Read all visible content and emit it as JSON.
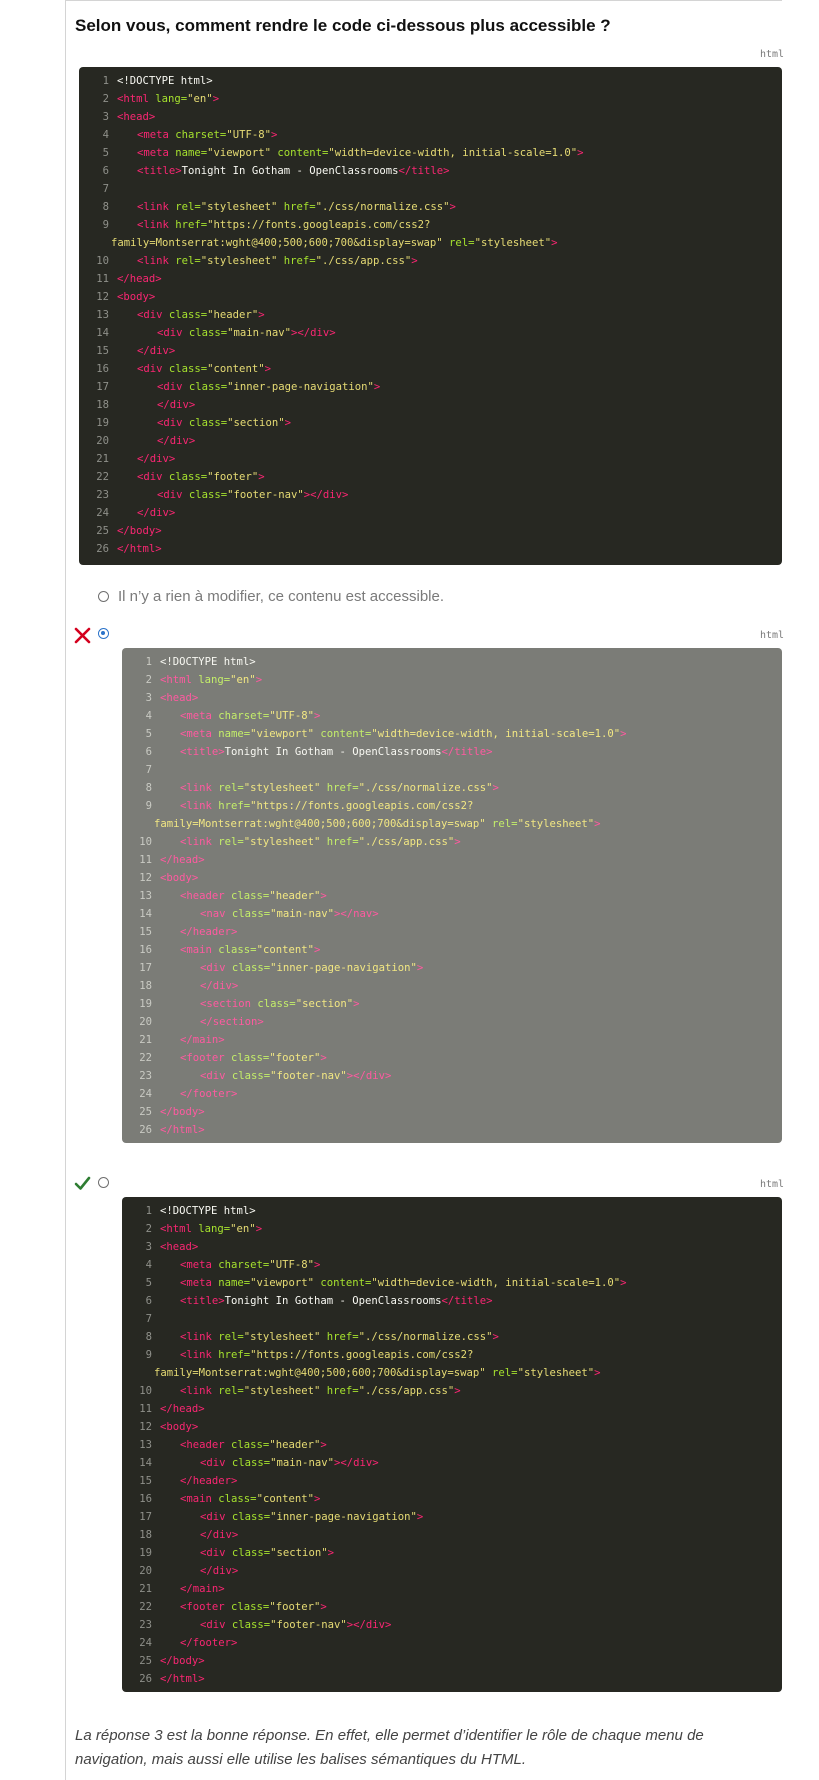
{
  "question": "Selon vous, comment rendre le code ci-dessous plus accessible ?",
  "lang_label": "html",
  "colors": {
    "tag": "#f92672",
    "attr": "#a6e22e",
    "string": "#e6db74",
    "text": "#f8f8f2",
    "wrong": "#d4001e",
    "right": "#2e7d32",
    "radio_selected": "#2a72c9"
  },
  "icons": {
    "wrong": "cross-icon",
    "right": "checkmark-icon"
  },
  "original_code": [
    {
      "n": "1",
      "x": 0,
      "s": [
        [
          "d",
          "<!DOCTYPE html>"
        ]
      ]
    },
    {
      "n": "2",
      "x": 0,
      "s": [
        [
          "t",
          "<html "
        ],
        [
          "a",
          "lang="
        ],
        [
          "s",
          "\"en\""
        ],
        [
          "t",
          ">"
        ]
      ]
    },
    {
      "n": "3",
      "x": 0,
      "s": [
        [
          "t",
          "<head>"
        ]
      ]
    },
    {
      "n": "4",
      "x": 1,
      "s": [
        [
          "t",
          "<meta "
        ],
        [
          "a",
          "charset="
        ],
        [
          "s",
          "\"UTF-8\""
        ],
        [
          "t",
          ">"
        ]
      ]
    },
    {
      "n": "5",
      "x": 1,
      "s": [
        [
          "t",
          "<meta "
        ],
        [
          "a",
          "name="
        ],
        [
          "s",
          "\"viewport\" "
        ],
        [
          "a",
          "content="
        ],
        [
          "s",
          "\"width=device-width, initial-scale=1.0\""
        ],
        [
          "t",
          ">"
        ]
      ]
    },
    {
      "n": "6",
      "x": 1,
      "s": [
        [
          "t",
          "<title>"
        ],
        [
          "p",
          "Tonight In Gotham - OpenClassrooms"
        ],
        [
          "t",
          "</title>"
        ]
      ]
    },
    {
      "n": "7",
      "x": 0,
      "s": []
    },
    {
      "n": "8",
      "x": 1,
      "s": [
        [
          "t",
          "<link "
        ],
        [
          "a",
          "rel="
        ],
        [
          "s",
          "\"stylesheet\" "
        ],
        [
          "a",
          "href="
        ],
        [
          "s",
          "\"./css/normalize.css\""
        ],
        [
          "t",
          ">"
        ]
      ]
    },
    {
      "n": "9",
      "x": 1,
      "s": [
        [
          "t",
          "<link "
        ],
        [
          "a",
          "href="
        ],
        [
          "s",
          "\"https://fonts.googleapis.com/css2?"
        ]
      ]
    },
    {
      "n": "",
      "x": -1,
      "s": [
        [
          "s",
          "family=Montserrat:wght@400;500;600;700&display=swap\" "
        ],
        [
          "a",
          "rel="
        ],
        [
          "s",
          "\"stylesheet\""
        ],
        [
          "t",
          ">"
        ]
      ]
    },
    {
      "n": "10",
      "x": 1,
      "s": [
        [
          "t",
          "<link "
        ],
        [
          "a",
          "rel="
        ],
        [
          "s",
          "\"stylesheet\" "
        ],
        [
          "a",
          "href="
        ],
        [
          "s",
          "\"./css/app.css\""
        ],
        [
          "t",
          ">"
        ]
      ]
    },
    {
      "n": "11",
      "x": 0,
      "s": [
        [
          "t",
          "</head>"
        ]
      ]
    },
    {
      "n": "12",
      "x": 0,
      "s": [
        [
          "t",
          "<body>"
        ]
      ]
    },
    {
      "n": "13",
      "x": 1,
      "s": [
        [
          "t",
          "<div "
        ],
        [
          "a",
          "class="
        ],
        [
          "s",
          "\"header\""
        ],
        [
          "t",
          ">"
        ]
      ]
    },
    {
      "n": "14",
      "x": 2,
      "s": [
        [
          "t",
          "<div "
        ],
        [
          "a",
          "class="
        ],
        [
          "s",
          "\"main-nav\""
        ],
        [
          "t",
          "></div>"
        ]
      ]
    },
    {
      "n": "15",
      "x": 1,
      "s": [
        [
          "t",
          "</div>"
        ]
      ]
    },
    {
      "n": "16",
      "x": 1,
      "s": [
        [
          "t",
          "<div "
        ],
        [
          "a",
          "class="
        ],
        [
          "s",
          "\"content\""
        ],
        [
          "t",
          ">"
        ]
      ]
    },
    {
      "n": "17",
      "x": 2,
      "s": [
        [
          "t",
          "<div "
        ],
        [
          "a",
          "class="
        ],
        [
          "s",
          "\"inner-page-navigation\""
        ],
        [
          "t",
          ">"
        ]
      ]
    },
    {
      "n": "18",
      "x": 2,
      "s": [
        [
          "t",
          "</div>"
        ]
      ]
    },
    {
      "n": "19",
      "x": 2,
      "s": [
        [
          "t",
          "<div "
        ],
        [
          "a",
          "class="
        ],
        [
          "s",
          "\"section\""
        ],
        [
          "t",
          ">"
        ]
      ]
    },
    {
      "n": "20",
      "x": 2,
      "s": [
        [
          "t",
          "</div>"
        ]
      ]
    },
    {
      "n": "21",
      "x": 1,
      "s": [
        [
          "t",
          "</div>"
        ]
      ]
    },
    {
      "n": "22",
      "x": 1,
      "s": [
        [
          "t",
          "<div "
        ],
        [
          "a",
          "class="
        ],
        [
          "s",
          "\"footer\""
        ],
        [
          "t",
          ">"
        ]
      ]
    },
    {
      "n": "23",
      "x": 2,
      "s": [
        [
          "t",
          "<div "
        ],
        [
          "a",
          "class="
        ],
        [
          "s",
          "\"footer-nav\""
        ],
        [
          "t",
          "></div>"
        ]
      ]
    },
    {
      "n": "24",
      "x": 1,
      "s": [
        [
          "t",
          "</div>"
        ]
      ]
    },
    {
      "n": "25",
      "x": 0,
      "s": [
        [
          "t",
          "</body>"
        ]
      ]
    },
    {
      "n": "26",
      "x": 0,
      "s": [
        [
          "t",
          "</html>"
        ]
      ]
    }
  ],
  "option1": {
    "label": "Il n’y a rien à modifier, ce contenu est accessible."
  },
  "option2_code": [
    {
      "n": "1",
      "x": 0,
      "s": [
        [
          "d",
          "<!DOCTYPE html>"
        ]
      ]
    },
    {
      "n": "2",
      "x": 0,
      "s": [
        [
          "t",
          "<html "
        ],
        [
          "a",
          "lang="
        ],
        [
          "s",
          "\"en\""
        ],
        [
          "t",
          ">"
        ]
      ]
    },
    {
      "n": "3",
      "x": 0,
      "s": [
        [
          "t",
          "<head>"
        ]
      ]
    },
    {
      "n": "4",
      "x": 1,
      "s": [
        [
          "t",
          "<meta "
        ],
        [
          "a",
          "charset="
        ],
        [
          "s",
          "\"UTF-8\""
        ],
        [
          "t",
          ">"
        ]
      ]
    },
    {
      "n": "5",
      "x": 1,
      "s": [
        [
          "t",
          "<meta "
        ],
        [
          "a",
          "name="
        ],
        [
          "s",
          "\"viewport\" "
        ],
        [
          "a",
          "content="
        ],
        [
          "s",
          "\"width=device-width, initial-scale=1.0\""
        ],
        [
          "t",
          ">"
        ]
      ]
    },
    {
      "n": "6",
      "x": 1,
      "s": [
        [
          "t",
          "<title>"
        ],
        [
          "p",
          "Tonight In Gotham - OpenClassrooms"
        ],
        [
          "t",
          "</title>"
        ]
      ]
    },
    {
      "n": "7",
      "x": 0,
      "s": []
    },
    {
      "n": "8",
      "x": 1,
      "s": [
        [
          "t",
          "<link "
        ],
        [
          "a",
          "rel="
        ],
        [
          "s",
          "\"stylesheet\" "
        ],
        [
          "a",
          "href="
        ],
        [
          "s",
          "\"./css/normalize.css\""
        ],
        [
          "t",
          ">"
        ]
      ]
    },
    {
      "n": "9",
      "x": 1,
      "s": [
        [
          "t",
          "<link "
        ],
        [
          "a",
          "href="
        ],
        [
          "s",
          "\"https://fonts.googleapis.com/css2?"
        ]
      ]
    },
    {
      "n": "",
      "x": -1,
      "s": [
        [
          "s",
          "family=Montserrat:wght@400;500;600;700&display=swap\" "
        ],
        [
          "a",
          "rel="
        ],
        [
          "s",
          "\"stylesheet\""
        ],
        [
          "t",
          ">"
        ]
      ]
    },
    {
      "n": "10",
      "x": 1,
      "s": [
        [
          "t",
          "<link "
        ],
        [
          "a",
          "rel="
        ],
        [
          "s",
          "\"stylesheet\" "
        ],
        [
          "a",
          "href="
        ],
        [
          "s",
          "\"./css/app.css\""
        ],
        [
          "t",
          ">"
        ]
      ]
    },
    {
      "n": "11",
      "x": 0,
      "s": [
        [
          "t",
          "</head>"
        ]
      ]
    },
    {
      "n": "12",
      "x": 0,
      "s": [
        [
          "t",
          "<body>"
        ]
      ]
    },
    {
      "n": "13",
      "x": 1,
      "s": [
        [
          "t",
          "<header "
        ],
        [
          "a",
          "class="
        ],
        [
          "s",
          "\"header\""
        ],
        [
          "t",
          ">"
        ]
      ]
    },
    {
      "n": "14",
      "x": 2,
      "s": [
        [
          "t",
          "<nav "
        ],
        [
          "a",
          "class="
        ],
        [
          "s",
          "\"main-nav\""
        ],
        [
          "t",
          "></nav>"
        ]
      ]
    },
    {
      "n": "15",
      "x": 1,
      "s": [
        [
          "t",
          "</header>"
        ]
      ]
    },
    {
      "n": "16",
      "x": 1,
      "s": [
        [
          "t",
          "<main "
        ],
        [
          "a",
          "class="
        ],
        [
          "s",
          "\"content\""
        ],
        [
          "t",
          ">"
        ]
      ]
    },
    {
      "n": "17",
      "x": 2,
      "s": [
        [
          "t",
          "<div "
        ],
        [
          "a",
          "class="
        ],
        [
          "s",
          "\"inner-page-navigation\""
        ],
        [
          "t",
          ">"
        ]
      ]
    },
    {
      "n": "18",
      "x": 2,
      "s": [
        [
          "t",
          "</div>"
        ]
      ]
    },
    {
      "n": "19",
      "x": 2,
      "s": [
        [
          "t",
          "<section "
        ],
        [
          "a",
          "class="
        ],
        [
          "s",
          "\"section\""
        ],
        [
          "t",
          ">"
        ]
      ]
    },
    {
      "n": "20",
      "x": 2,
      "s": [
        [
          "t",
          "</section>"
        ]
      ]
    },
    {
      "n": "21",
      "x": 1,
      "s": [
        [
          "t",
          "</main>"
        ]
      ]
    },
    {
      "n": "22",
      "x": 1,
      "s": [
        [
          "t",
          "<footer "
        ],
        [
          "a",
          "class="
        ],
        [
          "s",
          "\"footer\""
        ],
        [
          "t",
          ">"
        ]
      ]
    },
    {
      "n": "23",
      "x": 2,
      "s": [
        [
          "t",
          "<div "
        ],
        [
          "a",
          "class="
        ],
        [
          "s",
          "\"footer-nav\""
        ],
        [
          "t",
          "></div>"
        ]
      ]
    },
    {
      "n": "24",
      "x": 1,
      "s": [
        [
          "t",
          "</footer>"
        ]
      ]
    },
    {
      "n": "25",
      "x": 0,
      "s": [
        [
          "t",
          "</body>"
        ]
      ]
    },
    {
      "n": "26",
      "x": 0,
      "s": [
        [
          "t",
          "</html>"
        ]
      ]
    }
  ],
  "option3_code": [
    {
      "n": "1",
      "x": 0,
      "s": [
        [
          "d",
          "<!DOCTYPE html>"
        ]
      ]
    },
    {
      "n": "2",
      "x": 0,
      "s": [
        [
          "t",
          "<html "
        ],
        [
          "a",
          "lang="
        ],
        [
          "s",
          "\"en\""
        ],
        [
          "t",
          ">"
        ]
      ]
    },
    {
      "n": "3",
      "x": 0,
      "s": [
        [
          "t",
          "<head>"
        ]
      ]
    },
    {
      "n": "4",
      "x": 1,
      "s": [
        [
          "t",
          "<meta "
        ],
        [
          "a",
          "charset="
        ],
        [
          "s",
          "\"UTF-8\""
        ],
        [
          "t",
          ">"
        ]
      ]
    },
    {
      "n": "5",
      "x": 1,
      "s": [
        [
          "t",
          "<meta "
        ],
        [
          "a",
          "name="
        ],
        [
          "s",
          "\"viewport\" "
        ],
        [
          "a",
          "content="
        ],
        [
          "s",
          "\"width=device-width, initial-scale=1.0\""
        ],
        [
          "t",
          ">"
        ]
      ]
    },
    {
      "n": "6",
      "x": 1,
      "s": [
        [
          "t",
          "<title>"
        ],
        [
          "p",
          "Tonight In Gotham - OpenClassrooms"
        ],
        [
          "t",
          "</title>"
        ]
      ]
    },
    {
      "n": "7",
      "x": 0,
      "s": []
    },
    {
      "n": "8",
      "x": 1,
      "s": [
        [
          "t",
          "<link "
        ],
        [
          "a",
          "rel="
        ],
        [
          "s",
          "\"stylesheet\" "
        ],
        [
          "a",
          "href="
        ],
        [
          "s",
          "\"./css/normalize.css\""
        ],
        [
          "t",
          ">"
        ]
      ]
    },
    {
      "n": "9",
      "x": 1,
      "s": [
        [
          "t",
          "<link "
        ],
        [
          "a",
          "href="
        ],
        [
          "s",
          "\"https://fonts.googleapis.com/css2?"
        ]
      ]
    },
    {
      "n": "",
      "x": -1,
      "s": [
        [
          "s",
          "family=Montserrat:wght@400;500;600;700&display=swap\" "
        ],
        [
          "a",
          "rel="
        ],
        [
          "s",
          "\"stylesheet\""
        ],
        [
          "t",
          ">"
        ]
      ]
    },
    {
      "n": "10",
      "x": 1,
      "s": [
        [
          "t",
          "<link "
        ],
        [
          "a",
          "rel="
        ],
        [
          "s",
          "\"stylesheet\" "
        ],
        [
          "a",
          "href="
        ],
        [
          "s",
          "\"./css/app.css\""
        ],
        [
          "t",
          ">"
        ]
      ]
    },
    {
      "n": "11",
      "x": 0,
      "s": [
        [
          "t",
          "</head>"
        ]
      ]
    },
    {
      "n": "12",
      "x": 0,
      "s": [
        [
          "t",
          "<body>"
        ]
      ]
    },
    {
      "n": "13",
      "x": 1,
      "s": [
        [
          "t",
          "<header "
        ],
        [
          "a",
          "class="
        ],
        [
          "s",
          "\"header\""
        ],
        [
          "t",
          ">"
        ]
      ]
    },
    {
      "n": "14",
      "x": 2,
      "s": [
        [
          "t",
          "<div "
        ],
        [
          "a",
          "class="
        ],
        [
          "s",
          "\"main-nav\""
        ],
        [
          "t",
          "></div>"
        ]
      ]
    },
    {
      "n": "15",
      "x": 1,
      "s": [
        [
          "t",
          "</header>"
        ]
      ]
    },
    {
      "n": "16",
      "x": 1,
      "s": [
        [
          "t",
          "<main "
        ],
        [
          "a",
          "class="
        ],
        [
          "s",
          "\"content\""
        ],
        [
          "t",
          ">"
        ]
      ]
    },
    {
      "n": "17",
      "x": 2,
      "s": [
        [
          "t",
          "<div "
        ],
        [
          "a",
          "class="
        ],
        [
          "s",
          "\"inner-page-navigation\""
        ],
        [
          "t",
          ">"
        ]
      ]
    },
    {
      "n": "18",
      "x": 2,
      "s": [
        [
          "t",
          "</div>"
        ]
      ]
    },
    {
      "n": "19",
      "x": 2,
      "s": [
        [
          "t",
          "<div "
        ],
        [
          "a",
          "class="
        ],
        [
          "s",
          "\"section\""
        ],
        [
          "t",
          ">"
        ]
      ]
    },
    {
      "n": "20",
      "x": 2,
      "s": [
        [
          "t",
          "</div>"
        ]
      ]
    },
    {
      "n": "21",
      "x": 1,
      "s": [
        [
          "t",
          "</main>"
        ]
      ]
    },
    {
      "n": "22",
      "x": 1,
      "s": [
        [
          "t",
          "<footer "
        ],
        [
          "a",
          "class="
        ],
        [
          "s",
          "\"footer\""
        ],
        [
          "t",
          ">"
        ]
      ]
    },
    {
      "n": "23",
      "x": 2,
      "s": [
        [
          "t",
          "<div "
        ],
        [
          "a",
          "class="
        ],
        [
          "s",
          "\"footer-nav\""
        ],
        [
          "t",
          "></div>"
        ]
      ]
    },
    {
      "n": "24",
      "x": 1,
      "s": [
        [
          "t",
          "</footer>"
        ]
      ]
    },
    {
      "n": "25",
      "x": 0,
      "s": [
        [
          "t",
          "</body>"
        ]
      ]
    },
    {
      "n": "26",
      "x": 0,
      "s": [
        [
          "t",
          "</html>"
        ]
      ]
    }
  ],
  "explanation": "La réponse 3 est la bonne réponse. En effet, elle permet d’identifier le rôle de chaque menu de navigation, mais aussi elle utilise les balises sémantiques du HTML."
}
